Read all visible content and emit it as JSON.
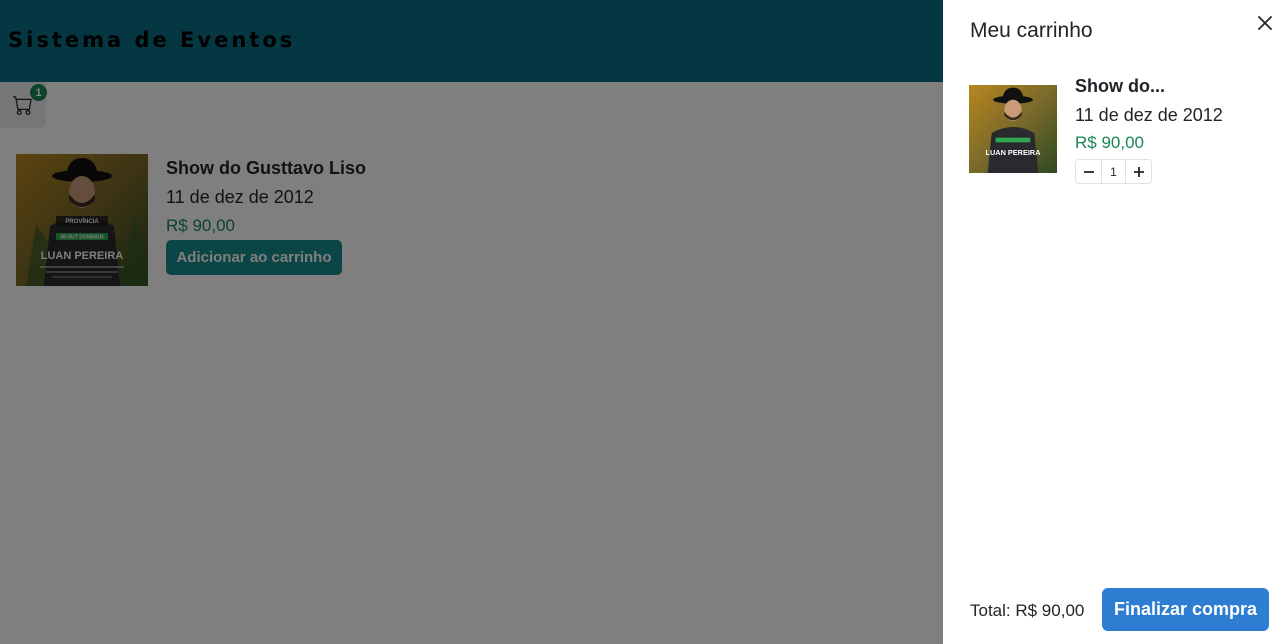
{
  "navbar": {
    "brand": "Sistema de Eventos"
  },
  "cart_button": {
    "icon": "cart-icon",
    "badge_count": "1"
  },
  "events": [
    {
      "title": "Show do Gusttavo Liso",
      "date": "11 de dez de 2012",
      "price": "R$ 90,00",
      "add_label": "Adicionar ao carrinho",
      "poster": {
        "headline": "LUAN PEREIRA",
        "tag": "08 OUT DOMINGO"
      }
    }
  ],
  "offcanvas": {
    "title": "Meu carrinho",
    "close_icon": "close-icon",
    "items": [
      {
        "title": "Show do...",
        "date": "11 de dez de 2012",
        "price": "R$ 90,00",
        "quantity": "1",
        "poster": {
          "headline": "LUAN PEREIRA"
        }
      }
    ],
    "total": "Total: R$ 90,00",
    "checkout_label": "Finalizar compra"
  },
  "colors": {
    "navbar": "#0b6e84",
    "price_green": "#198754",
    "add_button": "#198a8a",
    "checkout_button": "#2d7ed2"
  }
}
